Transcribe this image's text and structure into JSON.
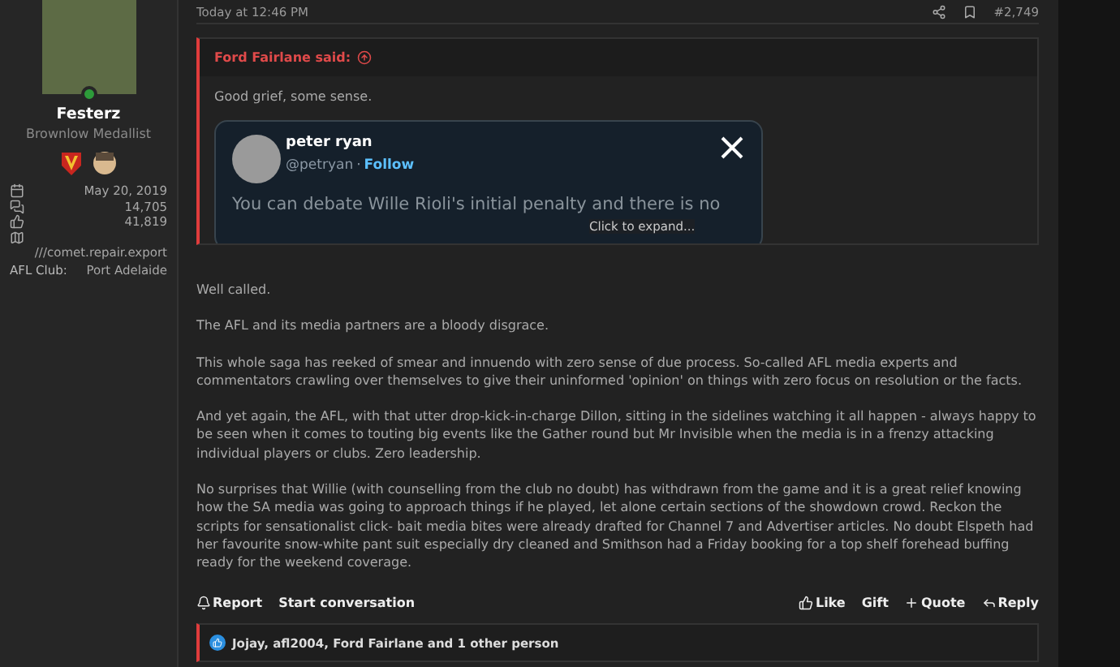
{
  "user": {
    "name": "Festerz",
    "title": "Brownlow Medallist",
    "online": true,
    "stats": [
      {
        "kind": "joined",
        "value": "May 20, 2019"
      },
      {
        "kind": "messages",
        "value": "14,705"
      },
      {
        "kind": "likes",
        "value": "41,819"
      },
      {
        "kind": "website",
        "value": "///comet.repair.export"
      }
    ],
    "club": {
      "label": "AFL Club:",
      "value": "Port Adelaide"
    }
  },
  "post": {
    "date": "Today at 12:46 PM",
    "number": "#2,749",
    "quote": {
      "author": "Ford Fairlane said:",
      "text": "Good grief, some sense.",
      "tweet": {
        "name": "peter ryan",
        "handle": "@petryan",
        "separator": "·",
        "follow": "Follow",
        "text": "You can debate Wille Rioli's initial penalty and there is no"
      },
      "expand": "Click to expand..."
    },
    "paragraphs": [
      "Well called.",
      "The AFL and its media partners are a bloody disgrace.",
      "This whole saga has reeked of smear and innuendo with zero sense of due process. So-called AFL media experts and commentators crawling over themselves to give their uninformed 'opinion' on things with zero focus on resolution or the facts.",
      "And yet again, the AFL, with that utter drop-kick-in-charge Dillon, sitting in the sidelines watching it all happen - always happy to be seen when it comes to touting big events like the Gather round but Mr Invisible when the media is in a frenzy attacking individual players or clubs. Zero leadership.",
      "No surprises that Willie (with counselling from the club no doubt) has withdrawn from the game and it is a great relief knowing how the SA media was going to approach things if he played, let alone certain sections of the showdown crowd. Reckon the scripts for sensationalist click- bait media bites were already drafted for Channel 7 and Advertiser articles. No doubt Elspeth had her favourite snow-white pant suit especially dry cleaned and Smithson had a Friday booking for a top shelf forehead buffing ready for the weekend coverage."
    ],
    "actions_left": [
      {
        "kind": "report",
        "label": "Report"
      },
      {
        "kind": "conversation",
        "label": "Start conversation"
      }
    ],
    "actions_right": [
      {
        "kind": "like",
        "label": "Like"
      },
      {
        "kind": "gift",
        "label": "Gift"
      },
      {
        "kind": "quote",
        "label": "Quote"
      },
      {
        "kind": "reply",
        "label": "Reply"
      }
    ],
    "reactions": "Jojay, afl2004, Ford Fairlane and 1 other person"
  }
}
